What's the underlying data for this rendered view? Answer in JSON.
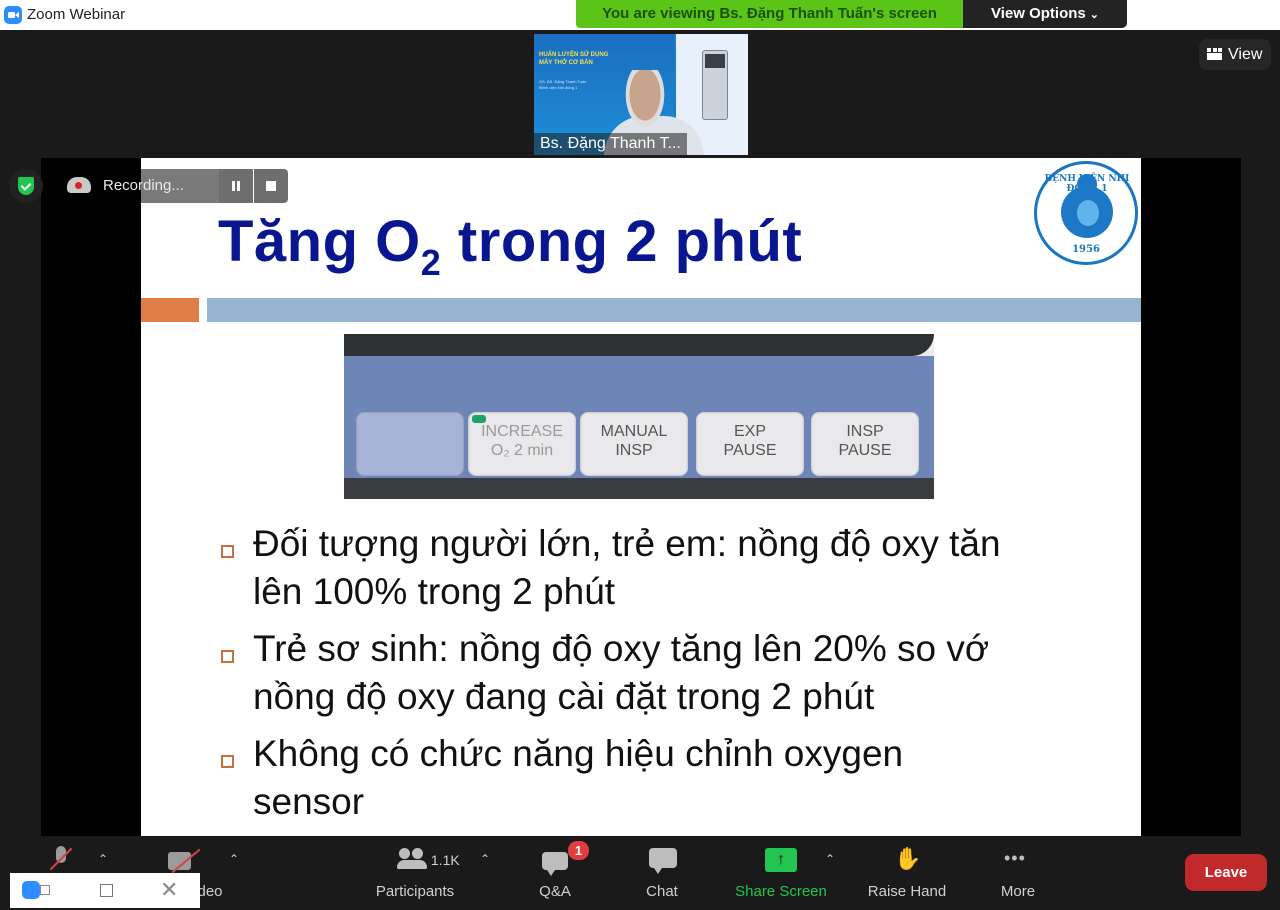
{
  "window": {
    "title": "Zoom Webinar"
  },
  "banner": {
    "viewing_text": "You are viewing Bs. Đặng Thanh Tuấn's screen",
    "view_options_label": "View Options",
    "accent_color": "#5ac517"
  },
  "video_tile": {
    "name": "Bs. Đặng Thanh T...",
    "slide_title_line1": "HUẤN LUYỆN SỬ DỤNG",
    "slide_title_line2": "MÁY THỞ CƠ BẢN",
    "slide_sub_line1": "GS. BS. Đặng Thanh Tuấn",
    "slide_sub_line2": "Bệnh viện Nhi đồng 1"
  },
  "view_button": {
    "label": "View"
  },
  "recording": {
    "label": "Recording..."
  },
  "slide": {
    "title_pre": "Tăng O",
    "title_sub": "2",
    "title_post": " trong 2 phút",
    "logo_text": "BỆNH VIỆN NHI ĐỒNG 1",
    "logo_year": "1956",
    "keys": [
      {
        "line1": "",
        "line2": ""
      },
      {
        "line1": "INCREASE",
        "line2": "O₂ 2 min"
      },
      {
        "line1": "MANUAL",
        "line2": "INSP"
      },
      {
        "line1": "EXP",
        "line2": "PAUSE"
      },
      {
        "line1": "INSP",
        "line2": "PAUSE"
      }
    ],
    "bullets": [
      {
        "line1": "Đối tượng người lớn, trẻ em: nồng độ oxy tăn",
        "line2": "lên 100% trong 2 phút"
      },
      {
        "line1": "Trẻ sơ sinh: nồng độ oxy tăng lên 20% so vớ",
        "line2": "nồng độ oxy đang cài đặt trong 2 phút"
      },
      {
        "line1": "Không có chức năng hiệu chỉnh oxygen",
        "line2": "sensor"
      }
    ]
  },
  "toolbar": {
    "video_label_partial": "deo",
    "participants_count": "1.1K",
    "participants_label": "Participants",
    "qa_label": "Q&A",
    "qa_badge": "1",
    "chat_label": "Chat",
    "share_label": "Share Screen",
    "raise_hand_label": "Raise Hand",
    "more_label": "More",
    "leave_label": "Leave",
    "share_color": "#23c552",
    "leave_color": "#c1292b"
  },
  "icons": {
    "caret": "⌃",
    "chevron": "⌄",
    "arrow_up": "↑",
    "hand": "✋",
    "more": "•••",
    "close": "✕"
  }
}
